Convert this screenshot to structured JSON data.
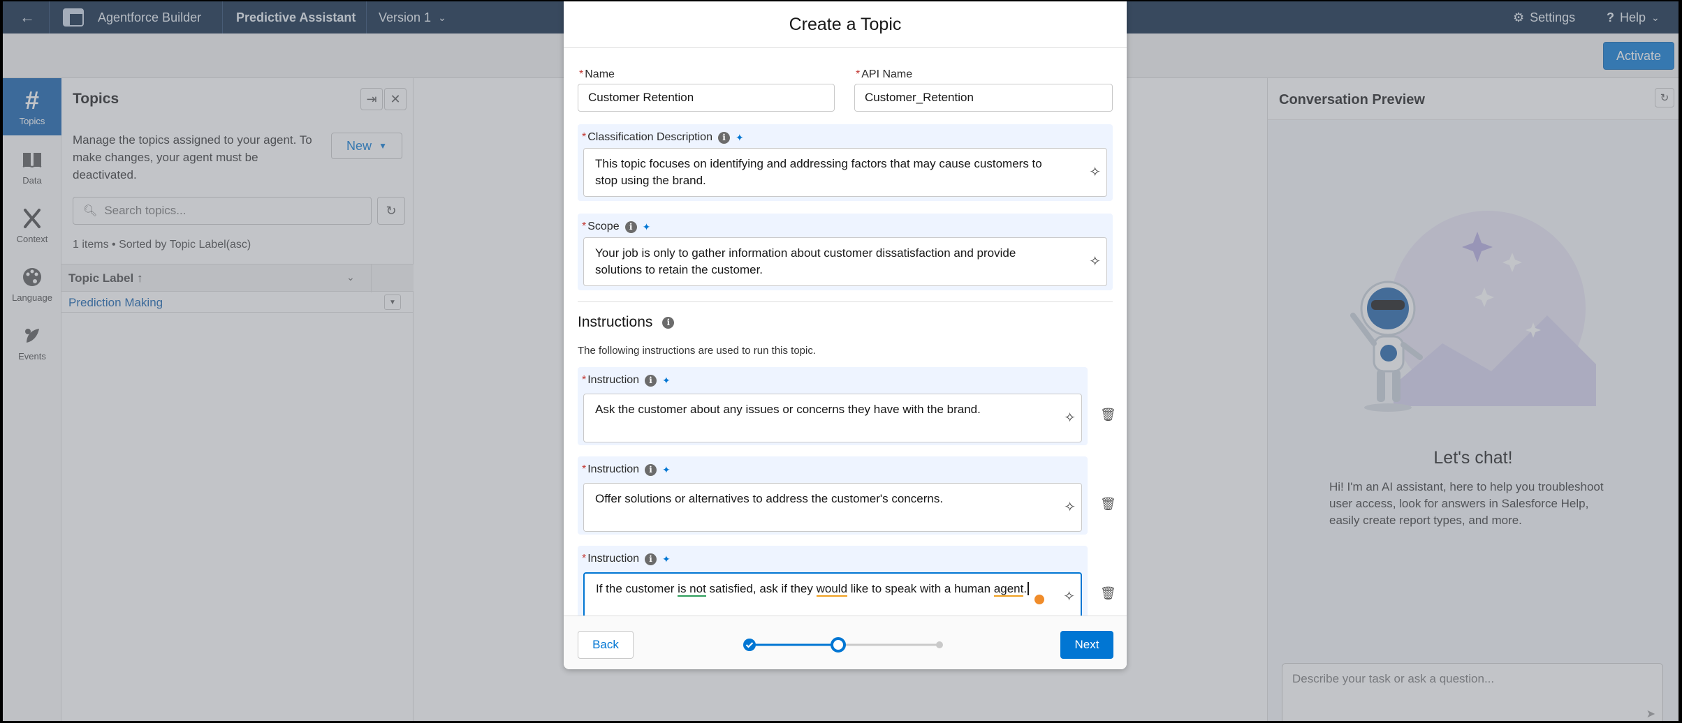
{
  "topbar": {
    "app_name": "Agentforce Builder",
    "agent_name": "Predictive Assistant",
    "version": "Version 1",
    "settings": "Settings",
    "help": "Help"
  },
  "subbar": {
    "activate": "Activate"
  },
  "rail": {
    "items": [
      {
        "label": "Topics",
        "icon": "hash-icon"
      },
      {
        "label": "Data",
        "icon": "book-icon"
      },
      {
        "label": "Context",
        "icon": "context-icon"
      },
      {
        "label": "Language",
        "icon": "palette-icon"
      },
      {
        "label": "Events",
        "icon": "events-icon"
      }
    ]
  },
  "topics": {
    "title": "Topics",
    "description": "Manage the topics assigned to your agent. To make changes, your agent must be deactivated.",
    "new_label": "New",
    "search_placeholder": "Search topics...",
    "sorted_text": "1 items • Sorted by Topic Label(asc)",
    "column_label": "Topic Label",
    "rows": [
      "Prediction Making"
    ]
  },
  "preview": {
    "title": "Conversation Preview",
    "lets_chat": "Let's chat!",
    "description": "Hi! I'm an AI assistant, here to help you troubleshoot user access, look for answers in Salesforce Help, easily create report types, and more.",
    "input_placeholder": "Describe your task or ask a question..."
  },
  "modal": {
    "title": "Create a Topic",
    "name_label": "Name",
    "name_value": "Customer Retention",
    "api_label": "API Name",
    "api_value": "Customer_Retention",
    "classification_label": "Classification Description",
    "classification_value": "This topic focuses on identifying and addressing factors that may cause customers to stop using the brand.",
    "scope_label": "Scope",
    "scope_value": "Your job is only to gather information about customer dissatisfaction and provide solutions to retain the customer.",
    "instructions_title": "Instructions",
    "instructions_desc": "The following instructions are used to run this topic.",
    "instruction_label": "Instruction",
    "instructions": [
      "Ask the customer about any issues or concerns they have with the brand.",
      "Offer solutions or alternatives to address the customer's concerns."
    ],
    "instruction3": {
      "p1": "If the customer ",
      "u1": "is not",
      "p2": " satisfied, ask if they ",
      "u2": "would",
      "p3": " like to speak with a human ",
      "u3": "agent",
      "p4": "."
    },
    "back": "Back",
    "next": "Next"
  }
}
